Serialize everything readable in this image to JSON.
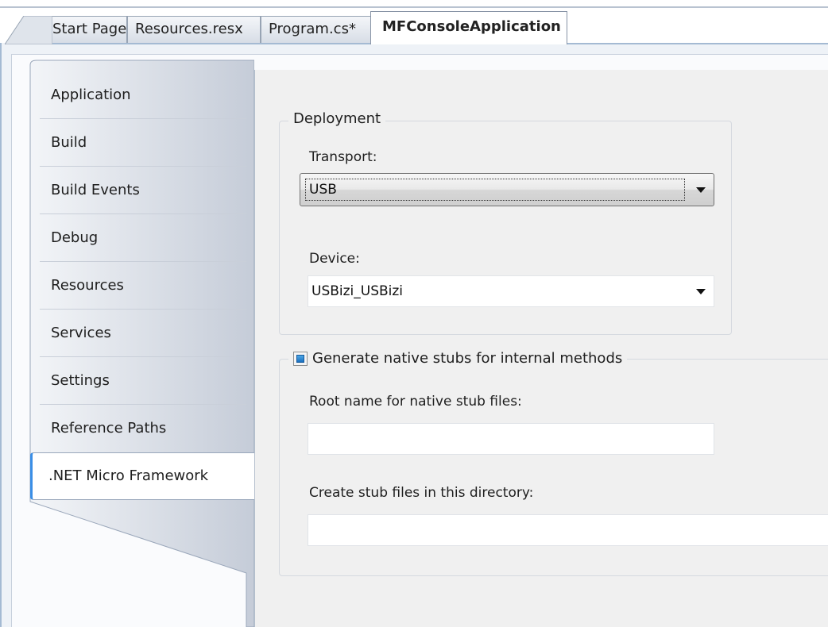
{
  "tabs": [
    {
      "label": "Start Page",
      "active": false
    },
    {
      "label": "Resources.resx",
      "active": false
    },
    {
      "label": "Program.cs*",
      "active": false
    },
    {
      "label": "MFConsoleApplication",
      "active": true
    }
  ],
  "nav": {
    "items": [
      {
        "label": "Application"
      },
      {
        "label": "Build"
      },
      {
        "label": "Build Events"
      },
      {
        "label": "Debug"
      },
      {
        "label": "Resources"
      },
      {
        "label": "Services"
      },
      {
        "label": "Settings"
      },
      {
        "label": "Reference Paths"
      },
      {
        "label": ".NET Micro Framework",
        "active": true
      }
    ]
  },
  "deployment": {
    "title": "Deployment",
    "transport_label": "Transport:",
    "transport_value": "USB",
    "device_label": "Device:",
    "device_value": "USBizi_USBizi"
  },
  "stubs": {
    "checkbox_label": "Generate native stubs for internal methods",
    "checked": true,
    "root_name_label": "Root name for native stub files:",
    "root_name_value": "",
    "directory_label": "Create stub files in this directory:",
    "directory_value": ""
  },
  "colors": {
    "accent": "#3a8ee6",
    "content_bg": "#f0f0f0"
  }
}
